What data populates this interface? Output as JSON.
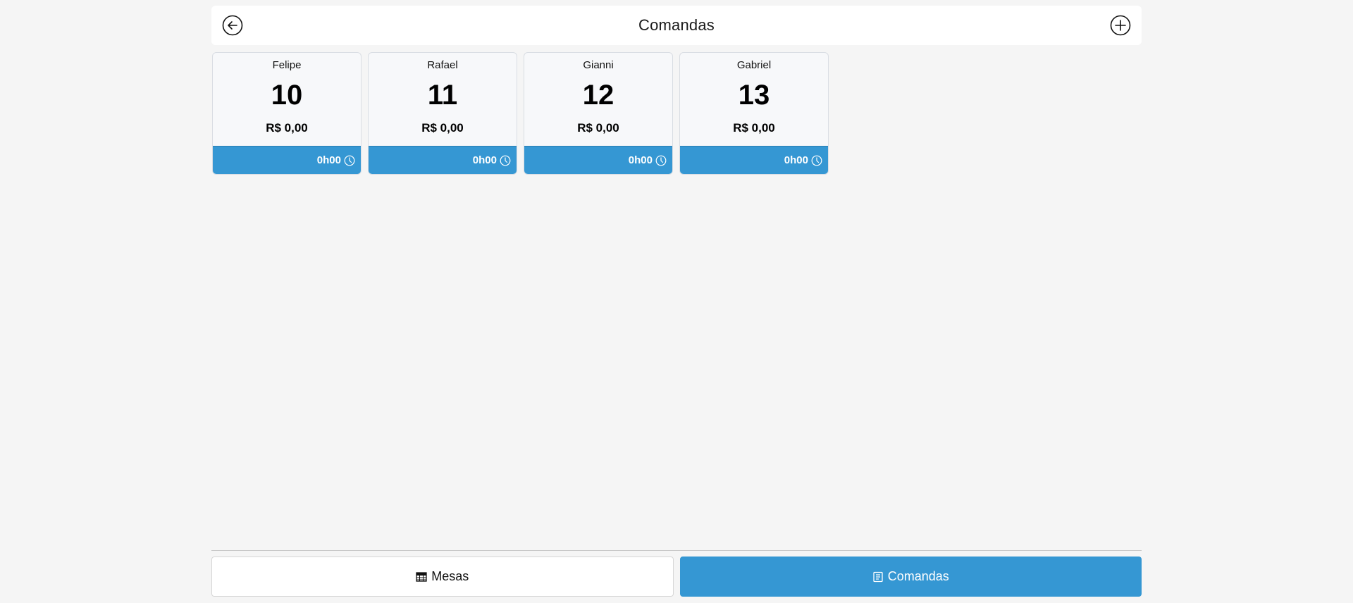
{
  "header": {
    "title": "Comandas",
    "back_icon": "arrow-left-circle-icon",
    "add_icon": "plus-circle-icon"
  },
  "comandas": [
    {
      "name": "Felipe",
      "number": "10",
      "total": "R$ 0,00",
      "time": "0h00"
    },
    {
      "name": "Rafael",
      "number": "11",
      "total": "R$ 0,00",
      "time": "0h00"
    },
    {
      "name": "Gianni",
      "number": "12",
      "total": "R$ 0,00",
      "time": "0h00"
    },
    {
      "name": "Gabriel",
      "number": "13",
      "total": "R$ 0,00",
      "time": "0h00"
    }
  ],
  "bottom_nav": {
    "mesas_label": "Mesas",
    "comandas_label": "Comandas",
    "active": "comandas"
  },
  "colors": {
    "accent": "#3597d3",
    "background": "#f5f5f5",
    "card_background": "#f7f8fa"
  }
}
